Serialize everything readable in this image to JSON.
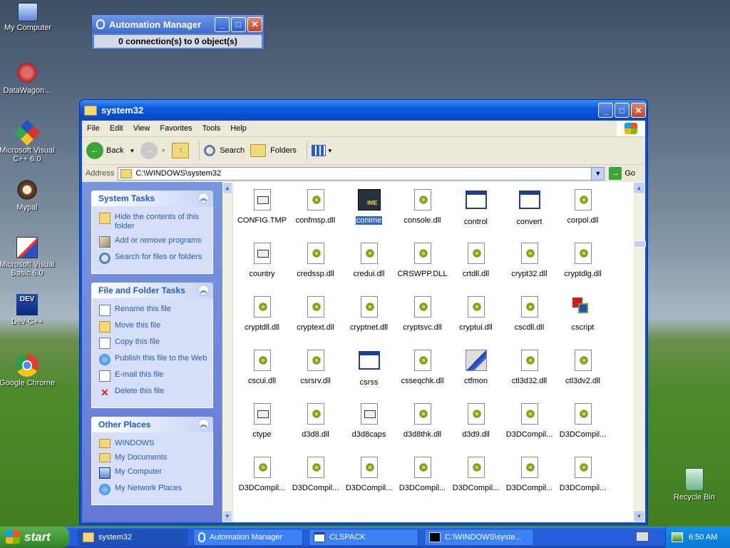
{
  "desktop": {
    "icons": [
      {
        "label": "My Computer"
      },
      {
        "label": "DataWagon..."
      },
      {
        "label": "Microsoft Visual C++ 6.0"
      },
      {
        "label": "Mypal"
      },
      {
        "label": "Microsoft Visual Basic 6.0"
      },
      {
        "label": "Dev-C++"
      },
      {
        "label": "Google Chrome"
      },
      {
        "label": "Recycle Bin"
      }
    ]
  },
  "automation_manager": {
    "title": "Automation Manager",
    "status": "0 connection(s) to 0 object(s)"
  },
  "explorer": {
    "title": "system32",
    "menu": [
      "File",
      "Edit",
      "View",
      "Favorites",
      "Tools",
      "Help"
    ],
    "toolbar": {
      "back": "Back",
      "search": "Search",
      "folders": "Folders"
    },
    "address": {
      "label": "Address",
      "value": "C:\\WINDOWS\\system32",
      "go": "Go"
    },
    "system_tasks": {
      "title": "System Tasks",
      "items": [
        {
          "label": "Hide the contents of this folder"
        },
        {
          "label": "Add or remove programs"
        },
        {
          "label": "Search for files or folders"
        }
      ]
    },
    "file_tasks": {
      "title": "File and Folder Tasks",
      "items": [
        {
          "label": "Rename this file"
        },
        {
          "label": "Move this file"
        },
        {
          "label": "Copy this file"
        },
        {
          "label": "Publish this file to the Web"
        },
        {
          "label": "E-mail this file"
        },
        {
          "label": "Delete this file"
        }
      ]
    },
    "other_places": {
      "title": "Other Places",
      "items": [
        {
          "label": "WINDOWS"
        },
        {
          "label": "My Documents"
        },
        {
          "label": "My Computer"
        },
        {
          "label": "My Network Places"
        }
      ]
    },
    "files": [
      {
        "name": "CONFIG.TMP",
        "icon": "document-icon"
      },
      {
        "name": "confmsp.dll",
        "icon": "dll-icon"
      },
      {
        "name": "conime",
        "icon": "ime-icon",
        "selected": true
      },
      {
        "name": "console.dll",
        "icon": "dll-icon"
      },
      {
        "name": "control",
        "icon": "window-app-icon"
      },
      {
        "name": "convert",
        "icon": "window-app-icon"
      },
      {
        "name": "corpol.dll",
        "icon": "dll-icon"
      },
      {
        "name": "country",
        "icon": "document-icon"
      },
      {
        "name": "credssp.dll",
        "icon": "dll-icon"
      },
      {
        "name": "credui.dll",
        "icon": "dll-icon"
      },
      {
        "name": "CRSWPP.DLL",
        "icon": "dll-icon"
      },
      {
        "name": "crtdll.dll",
        "icon": "dll-icon"
      },
      {
        "name": "crypt32.dll",
        "icon": "dll-icon"
      },
      {
        "name": "cryptdlg.dll",
        "icon": "dll-icon"
      },
      {
        "name": "cryptdll.dll",
        "icon": "dll-icon"
      },
      {
        "name": "cryptext.dll",
        "icon": "dll-icon"
      },
      {
        "name": "cryptnet.dll",
        "icon": "dll-icon"
      },
      {
        "name": "cryptsvc.dll",
        "icon": "dll-icon"
      },
      {
        "name": "cryptui.dll",
        "icon": "dll-icon"
      },
      {
        "name": "cscdll.dll",
        "icon": "dll-icon"
      },
      {
        "name": "cscript",
        "icon": "script-icon"
      },
      {
        "name": "cscui.dll",
        "icon": "dll-icon"
      },
      {
        "name": "csrsrv.dll",
        "icon": "dll-icon"
      },
      {
        "name": "csrss",
        "icon": "window-app-icon"
      },
      {
        "name": "csseqchk.dll",
        "icon": "dll-icon"
      },
      {
        "name": "ctfmon",
        "icon": "pen-icon"
      },
      {
        "name": "ctl3d32.dll",
        "icon": "dll-icon"
      },
      {
        "name": "ctl3dv2.dll",
        "icon": "dll-icon"
      },
      {
        "name": "ctype",
        "icon": "document-icon"
      },
      {
        "name": "d3d8.dll",
        "icon": "dll-icon"
      },
      {
        "name": "d3d8caps",
        "icon": "document-icon"
      },
      {
        "name": "d3d8thk.dll",
        "icon": "dll-icon"
      },
      {
        "name": "d3d9.dll",
        "icon": "dll-icon"
      },
      {
        "name": "D3DCompil...",
        "icon": "dll-icon"
      },
      {
        "name": "D3DCompil...",
        "icon": "dll-icon"
      },
      {
        "name": "D3DCompil...",
        "icon": "dll-icon"
      },
      {
        "name": "D3DCompil...",
        "icon": "dll-icon"
      },
      {
        "name": "D3DCompil...",
        "icon": "dll-icon"
      },
      {
        "name": "D3DCompil...",
        "icon": "dll-icon"
      },
      {
        "name": "D3DCompil...",
        "icon": "dll-icon"
      },
      {
        "name": "D3DCompil...",
        "icon": "dll-icon"
      },
      {
        "name": "D3DCompil...",
        "icon": "dll-icon"
      }
    ]
  },
  "taskbar": {
    "start": "start",
    "tasks": [
      {
        "label": "system32"
      },
      {
        "label": "Automation Manager"
      },
      {
        "label": "CLSPACK"
      },
      {
        "label": "C:\\WINDOWS\\syste..."
      }
    ],
    "clock": "6:50 AM"
  }
}
